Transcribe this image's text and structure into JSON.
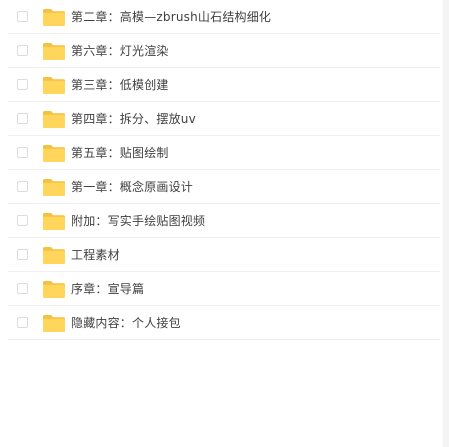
{
  "file_list": {
    "items": [
      {
        "name": "第二章：高模—zbrush山石结构细化",
        "type": "folder"
      },
      {
        "name": "第六章：灯光渲染",
        "type": "folder"
      },
      {
        "name": "第三章：低模创建",
        "type": "folder"
      },
      {
        "name": "第四章：拆分、摆放uv",
        "type": "folder"
      },
      {
        "name": "第五章：贴图绘制",
        "type": "folder"
      },
      {
        "name": "第一章：概念原画设计",
        "type": "folder"
      },
      {
        "name": "附加：写实手绘贴图视频",
        "type": "folder"
      },
      {
        "name": "工程素材",
        "type": "folder"
      },
      {
        "name": "序章：宣导篇",
        "type": "folder"
      },
      {
        "name": "隐藏内容：个人接包",
        "type": "folder"
      }
    ]
  },
  "icons": {
    "folder": "folder-icon",
    "checkbox": "checkbox"
  },
  "colors": {
    "folder_body": "#FFD55C",
    "folder_tab": "#F5C13F",
    "text": "#404040",
    "divider": "#F0F0F0",
    "checkbox_border": "#DCDCDC"
  }
}
